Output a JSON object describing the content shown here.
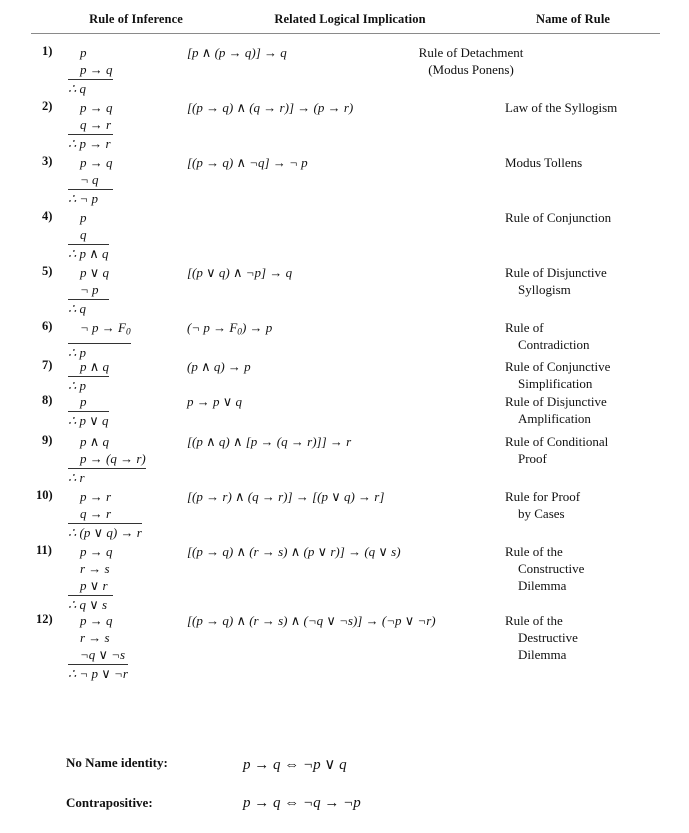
{
  "table": {
    "headers": {
      "col1": "Rule of Inference",
      "col2": "Related Logical Implication",
      "col3": "Name of Rule"
    },
    "rows": [
      {
        "num": "1)",
        "premises": [
          "p",
          "p → q"
        ],
        "conclusion": "∴ q",
        "implication": "[p ∧ (p → q)] → q",
        "name_lines": [
          "Rule of Detachment",
          "(Modus Ponens)"
        ],
        "name_centered": true
      },
      {
        "num": "2)",
        "premises": [
          "p → q",
          "q → r"
        ],
        "conclusion": "∴ p → r",
        "implication": "[(p → q) ∧ (q → r)] → (p → r)",
        "name_lines": [
          "Law of the Syllogism"
        ],
        "name_centered": false
      },
      {
        "num": "3)",
        "premises": [
          "p → q",
          "¬ q"
        ],
        "conclusion": "∴ ¬ p",
        "implication": "[(p → q) ∧ ¬q] → ¬ p",
        "name_lines": [
          "Modus Tollens"
        ],
        "name_centered": false
      },
      {
        "num": "4)",
        "premises": [
          "p",
          "q"
        ],
        "conclusion": "∴ p ∧ q",
        "implication": "",
        "name_lines": [
          "Rule of Conjunction"
        ],
        "name_centered": false
      },
      {
        "num": "5)",
        "premises": [
          "p ∨ q",
          "¬ p"
        ],
        "conclusion": "∴ q",
        "implication": "[(p ∨ q) ∧ ¬p] → q",
        "name_lines": [
          "Rule of Disjunctive",
          "Syllogism"
        ],
        "name_centered": false
      },
      {
        "num": "6)",
        "premises": [
          "¬ p → F0"
        ],
        "conclusion": "∴ p",
        "implication": "(¬ p → F0) → p",
        "name_lines": [
          "Rule of",
          "Contradiction"
        ],
        "name_centered": false
      },
      {
        "num": "7)",
        "premises": [
          "p ∧ q"
        ],
        "conclusion": "∴ p",
        "implication": "(p ∧ q) → p",
        "name_lines": [
          "Rule of Conjunctive",
          "Simplification"
        ],
        "name_centered": false
      },
      {
        "num": "8)",
        "premises": [
          "p"
        ],
        "conclusion": "∴ p ∨ q",
        "implication": "p → p ∨ q",
        "name_lines": [
          "Rule of Disjunctive",
          "Amplification"
        ],
        "name_centered": false
      },
      {
        "num": "9)",
        "premises": [
          "p ∧ q",
          "p → (q → r)"
        ],
        "conclusion": "∴ r",
        "implication": "[(p ∧ q) ∧ [p → (q → r)]] → r",
        "name_lines": [
          "Rule of Conditional",
          "Proof"
        ],
        "name_centered": false
      },
      {
        "num": "10)",
        "premises": [
          "p → r",
          "q → r"
        ],
        "conclusion": "∴ (p ∨ q) → r",
        "implication": "[(p → r) ∧ (q → r)] → [(p ∨ q) → r]",
        "name_lines": [
          "Rule for Proof",
          "by Cases"
        ],
        "name_centered": false
      },
      {
        "num": "11)",
        "premises": [
          "p → q",
          "r → s",
          "p ∨ r"
        ],
        "conclusion": "∴ q ∨ s",
        "implication": "[(p → q) ∧ (r → s) ∧ (p ∨ r)] → (q ∨ s)",
        "name_lines": [
          "Rule of the",
          "Constructive",
          "Dilemma"
        ],
        "name_centered": false
      },
      {
        "num": "12)",
        "premises": [
          "p → q",
          "r → s",
          "¬q ∨ ¬s"
        ],
        "conclusion": "∴ ¬ p ∨ ¬r",
        "implication": "[(p → q) ∧ (r → s) ∧ (¬q ∨ ¬s)] → (¬p ∨ ¬r)",
        "name_lines": [
          "Rule of the",
          "Destructive",
          "Dilemma"
        ],
        "name_centered": false
      }
    ]
  },
  "identities": [
    {
      "label": "No Name identity:",
      "expression": "p → q ⇔ ¬p ∨ q"
    },
    {
      "label": "Contrapositive:",
      "expression": "p → q ⇔ ¬q → ¬p"
    }
  ]
}
